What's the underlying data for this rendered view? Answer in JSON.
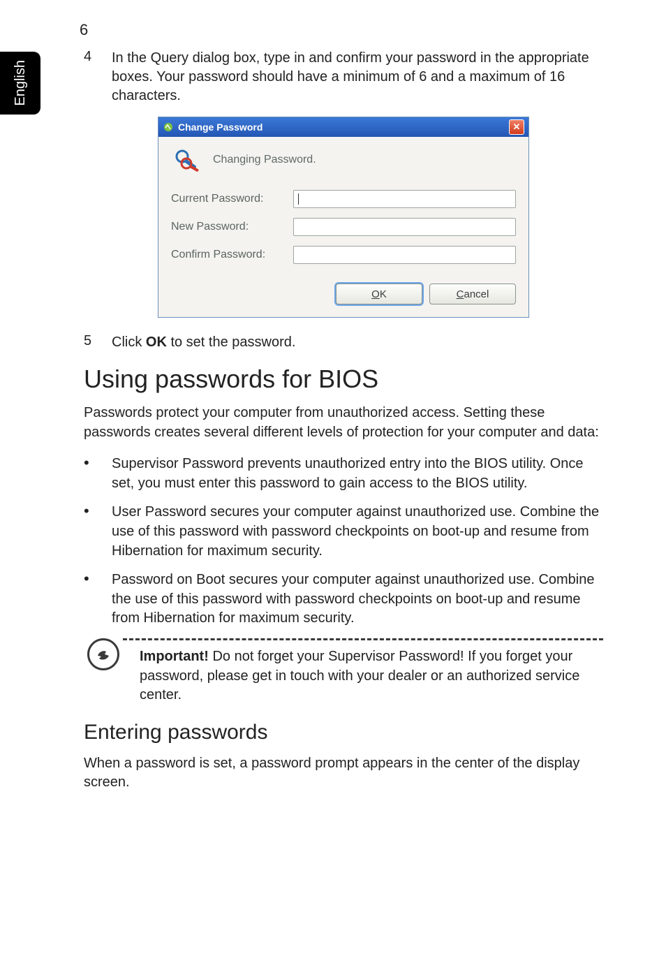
{
  "page_number": "6",
  "side_tab": "English",
  "step4": {
    "num": "4",
    "text": "In the Query dialog box, type in and confirm your  password in the appropriate boxes. Your password should have a minimum of 6 and a maximum of 16 characters."
  },
  "step5": {
    "num": "5",
    "prefix": "Click ",
    "bold": "OK",
    "suffix": " to set the password."
  },
  "dialog": {
    "title": "Change Password",
    "heading": "Changing Password.",
    "labels": {
      "current": "Current Password:",
      "newp": "New Password:",
      "confirm": "Confirm Password:"
    },
    "buttons": {
      "ok_u": "O",
      "ok_rest": "K",
      "cancel_u": "C",
      "cancel_rest": "ancel"
    }
  },
  "section_title": "Using passwords for BIOS",
  "intro": "Passwords protect your computer from unauthorized access. Setting these passwords creates several different levels of protection for your computer and data:",
  "bullets": [
    "Supervisor Password prevents unauthorized entry into the BIOS utility. Once set, you must enter this password to gain access to the BIOS utility.",
    "User Password secures your computer against unauthorized use. Combine the use of this password with password checkpoints on boot-up and resume from Hibernation for maximum security.",
    "Password on Boot secures your computer against unauthorized use. Combine the use of this password with password checkpoints on boot-up and resume from Hibernation for maximum security."
  ],
  "note": {
    "bold": "Important!",
    "text": " Do not forget your Supervisor Password! If you forget your password, please get in touch with your dealer or an authorized service center."
  },
  "sub_heading": "Entering passwords",
  "sub_text": "When a password is set, a password prompt appears in the center of the display screen."
}
